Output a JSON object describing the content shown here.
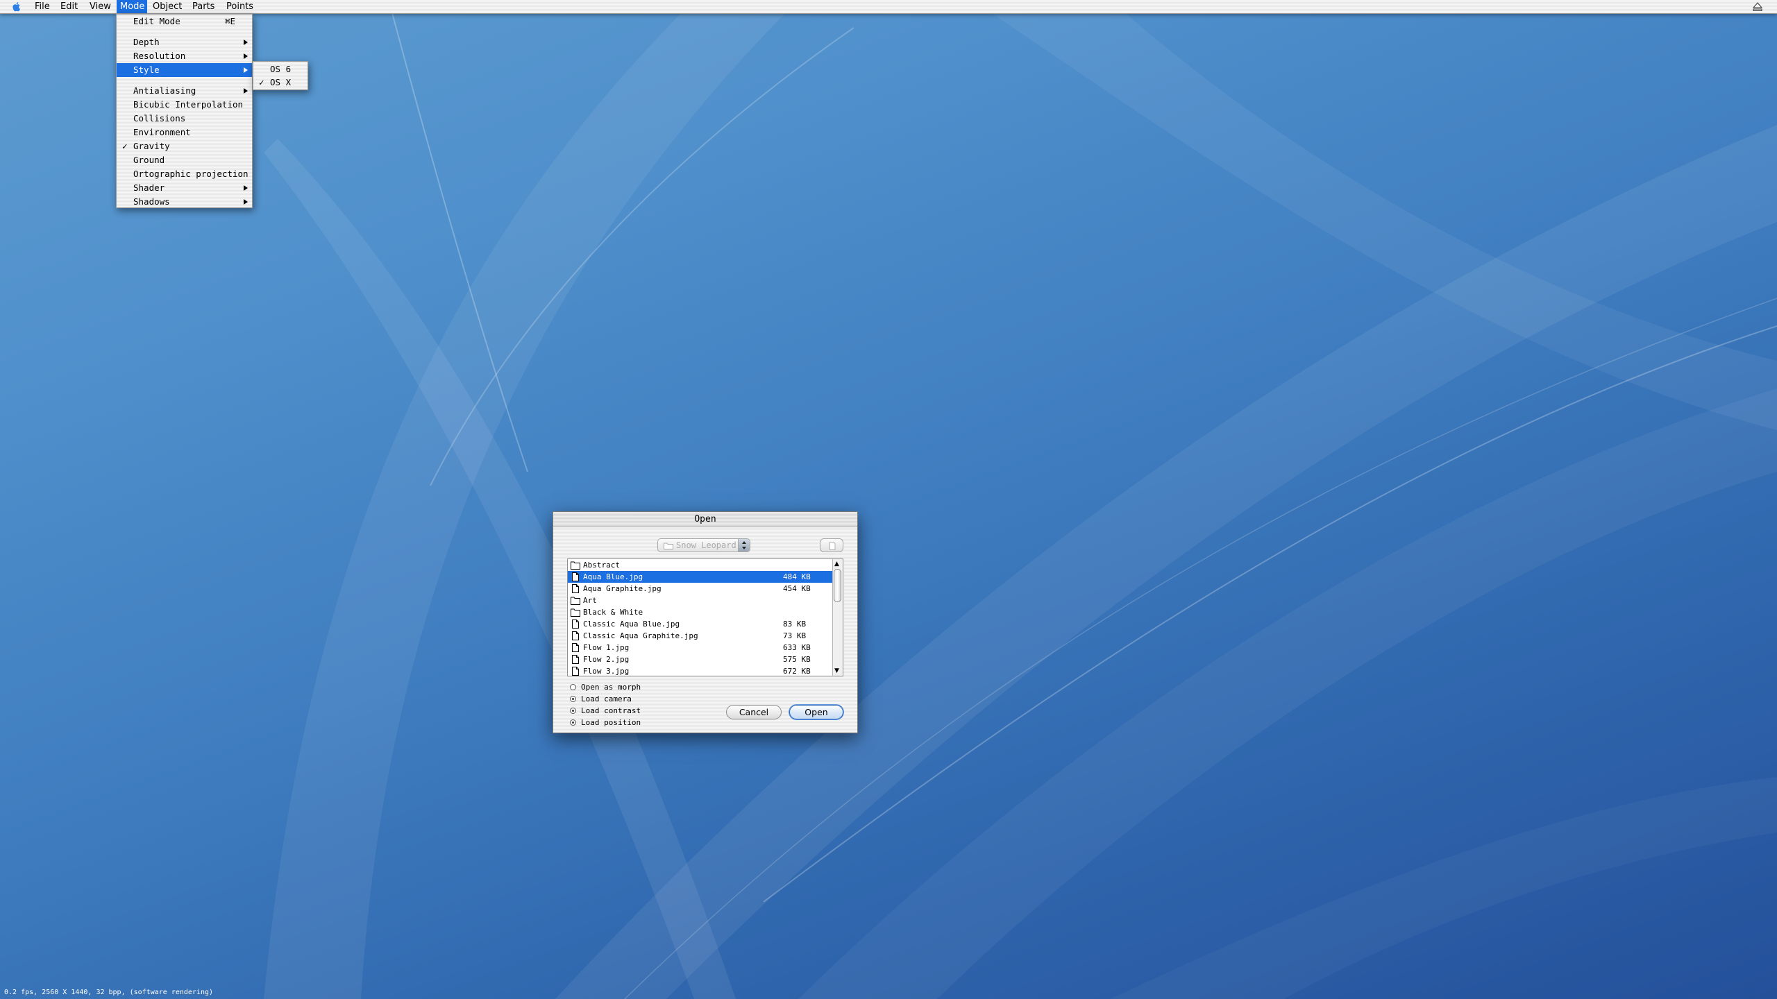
{
  "menubar": {
    "items": [
      {
        "label": "File"
      },
      {
        "label": "Edit"
      },
      {
        "label": "View"
      },
      {
        "label": "Mode"
      },
      {
        "label": "Object"
      },
      {
        "label": "Parts"
      },
      {
        "label": "Points"
      }
    ],
    "active_item": "Mode",
    "left_icon": "apple-icon",
    "right_icon": "eject-icon"
  },
  "mode_menu": {
    "items": [
      {
        "label": "Edit Mode",
        "shortcut": "⌘E"
      },
      {
        "label": "Depth",
        "submenu": true
      },
      {
        "label": "Resolution",
        "submenu": true
      },
      {
        "label": "Style",
        "submenu": true,
        "highlighted": true
      },
      {
        "label": "Antialiasing",
        "submenu": true
      },
      {
        "label": "Bicubic Interpolation"
      },
      {
        "label": "Collisions"
      },
      {
        "label": "Environment"
      },
      {
        "label": "Gravity",
        "checked": true
      },
      {
        "label": "Ground"
      },
      {
        "label": "Ortographic projection"
      },
      {
        "label": "Shader",
        "submenu": true
      },
      {
        "label": "Shadows",
        "submenu": true
      }
    ],
    "check_glyph": "✓"
  },
  "style_submenu": {
    "items": [
      {
        "label": "OS 6"
      },
      {
        "label": "OS X",
        "checked": true
      }
    ],
    "check_glyph": "✓"
  },
  "open_dialog": {
    "title": "Open",
    "location": "Snow Leopard",
    "files": [
      {
        "name": "Abstract",
        "size": "",
        "type": "folder"
      },
      {
        "name": "Aqua Blue.jpg",
        "size": "484 KB",
        "type": "file",
        "selected": true
      },
      {
        "name": "Aqua Graphite.jpg",
        "size": "454 KB",
        "type": "file"
      },
      {
        "name": "Art",
        "size": "",
        "type": "folder"
      },
      {
        "name": "Black & White",
        "size": "",
        "type": "folder"
      },
      {
        "name": "Classic Aqua Blue.jpg",
        "size": "83 KB",
        "type": "file"
      },
      {
        "name": "Classic Aqua Graphite.jpg",
        "size": "73 KB",
        "type": "file"
      },
      {
        "name": "Flow 1.jpg",
        "size": "633 KB",
        "type": "file"
      },
      {
        "name": "Flow 2.jpg",
        "size": "575 KB",
        "type": "file"
      },
      {
        "name": "Flow 3.jpg",
        "size": "672 KB",
        "type": "file"
      }
    ],
    "options": [
      {
        "label": "Open as morph",
        "checked": false
      },
      {
        "label": "Load camera",
        "checked": true
      },
      {
        "label": "Load contrast",
        "checked": true
      },
      {
        "label": "Load position",
        "checked": true
      }
    ],
    "cancel_label": "Cancel",
    "open_label": "Open",
    "scroll_up_glyph": "▲",
    "scroll_down_glyph": "▼"
  },
  "status": {
    "text": "0.2 fps, 2560 X 1440, 32 bpp, (software rendering)"
  },
  "colors": {
    "selection": "#1c6fe0",
    "desktop_top": "#5d9bd0",
    "desktop_bottom": "#24509a"
  }
}
